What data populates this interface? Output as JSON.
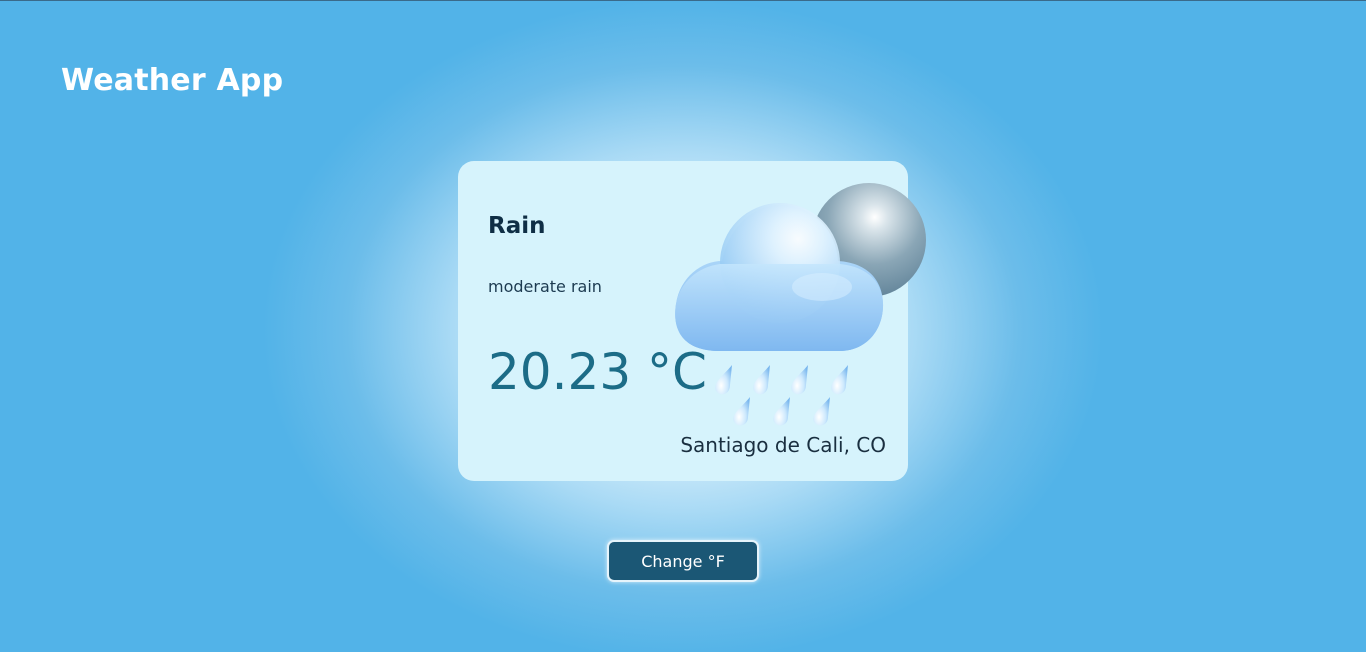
{
  "header": {
    "title": "Weather App"
  },
  "weather": {
    "condition": "Rain",
    "description": "moderate rain",
    "temperature": "20.23 °C",
    "location": "Santiago de Cali, CO",
    "icon": "moon-cloud-rain-icon"
  },
  "controls": {
    "change_unit_label": "Change °F"
  },
  "colors": {
    "background": "#52b3e8",
    "card": "#d6f3fc",
    "button": "#1b5775",
    "temperature_text": "#1c6c87"
  }
}
